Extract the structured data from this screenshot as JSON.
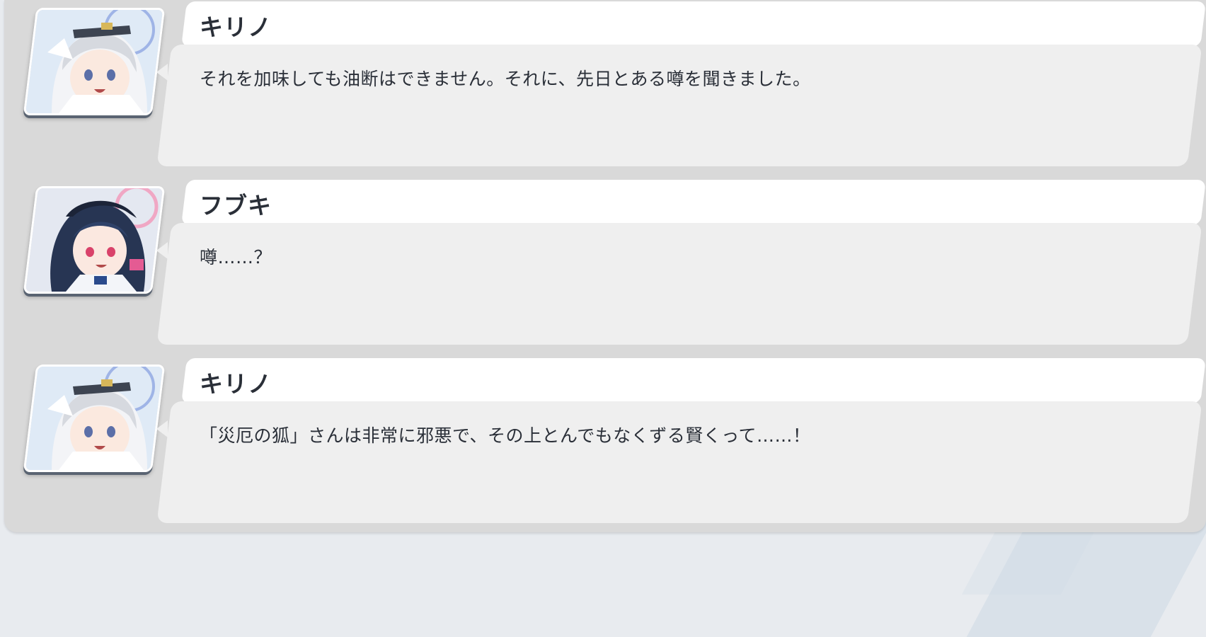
{
  "log": {
    "entries": [
      {
        "speaker": "キリノ",
        "portrait": "kirino-portrait",
        "text": "それを加味しても油断はできません。それに、先日とある噂を聞きました。"
      },
      {
        "speaker": "フブキ",
        "portrait": "fubuki-portrait",
        "text": "噂……？"
      },
      {
        "speaker": "キリノ",
        "portrait": "kirino-portrait",
        "text": "「災厄の狐」さんは非常に邪悪で、その上とんでもなくずる賢くって……！"
      }
    ]
  },
  "colors": {
    "panel": "#d9d9d9",
    "name_bar": "#ffffff",
    "bubble": "#efefef",
    "text": "#2a2f38",
    "portrait_frame_shadow": "#5a6472"
  }
}
